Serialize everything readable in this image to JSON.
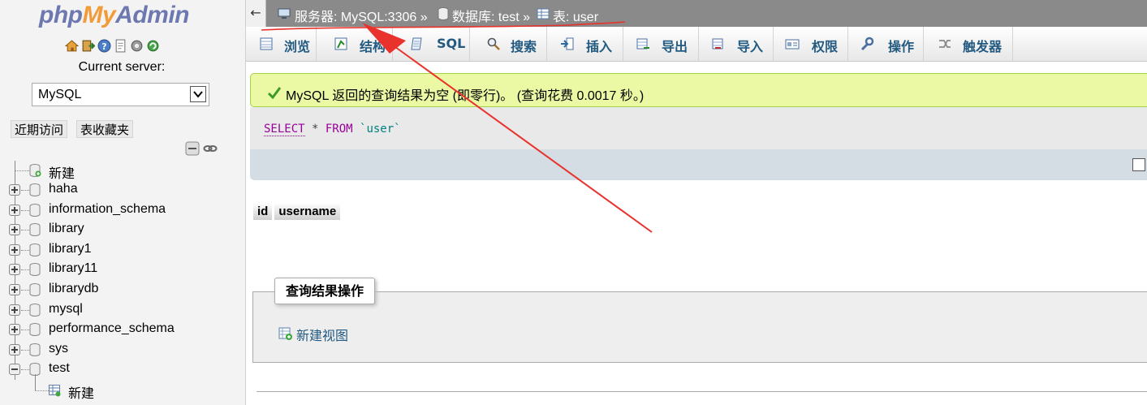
{
  "logo": {
    "php": "php",
    "my": "My",
    "admin": "Admin"
  },
  "nav_icons": [
    "home-icon",
    "exit-icon",
    "help-icon",
    "docs-icon",
    "settings-icon",
    "reload-icon"
  ],
  "server": {
    "label": "Current server:",
    "selected": "MySQL"
  },
  "recent": {
    "recent_label": "近期访问",
    "favorites_label": "表收藏夹"
  },
  "tree": {
    "items": [
      {
        "label": "新建"
      },
      {
        "label": "haha"
      },
      {
        "label": "information_schema"
      },
      {
        "label": "library"
      },
      {
        "label": "library1"
      },
      {
        "label": "library11"
      },
      {
        "label": "librarydb"
      },
      {
        "label": "mysql"
      },
      {
        "label": "performance_schema"
      },
      {
        "label": "sys"
      },
      {
        "label": "test"
      },
      {
        "label": "新建"
      }
    ]
  },
  "breadcrumb": {
    "back": "←",
    "server": "服务器: MySQL:3306 »",
    "database": "数据库: test »",
    "table": "表: user"
  },
  "tabs": [
    {
      "label": "浏览",
      "icon": "browse-icon"
    },
    {
      "label": "结构",
      "icon": "structure-icon"
    },
    {
      "label": "SQL",
      "icon": "sql-icon"
    },
    {
      "label": "搜索",
      "icon": "search-icon"
    },
    {
      "label": "插入",
      "icon": "insert-icon"
    },
    {
      "label": "导出",
      "icon": "export-icon"
    },
    {
      "label": "导入",
      "icon": "import-icon"
    },
    {
      "label": "权限",
      "icon": "privileges-icon"
    },
    {
      "label": "操作",
      "icon": "operations-icon"
    },
    {
      "label": "触发器",
      "icon": "triggers-icon"
    }
  ],
  "message": {
    "text": "MySQL 返回的查询结果为空 (即零行)。 (查询花费 0.0017 秒。)"
  },
  "sql": {
    "select": "SELECT",
    "star": " * ",
    "from": "FROM",
    "table": " `user`"
  },
  "result": {
    "columns": [
      "id",
      "username"
    ]
  },
  "query_ops": {
    "legend": "查询结果操作",
    "create_view": "新建视图"
  },
  "colors": {
    "accent_link": "#235a81",
    "success_bg": "#ebf8a4",
    "topbar": "#8a8a8a",
    "annotation_red": "#e8322b"
  }
}
